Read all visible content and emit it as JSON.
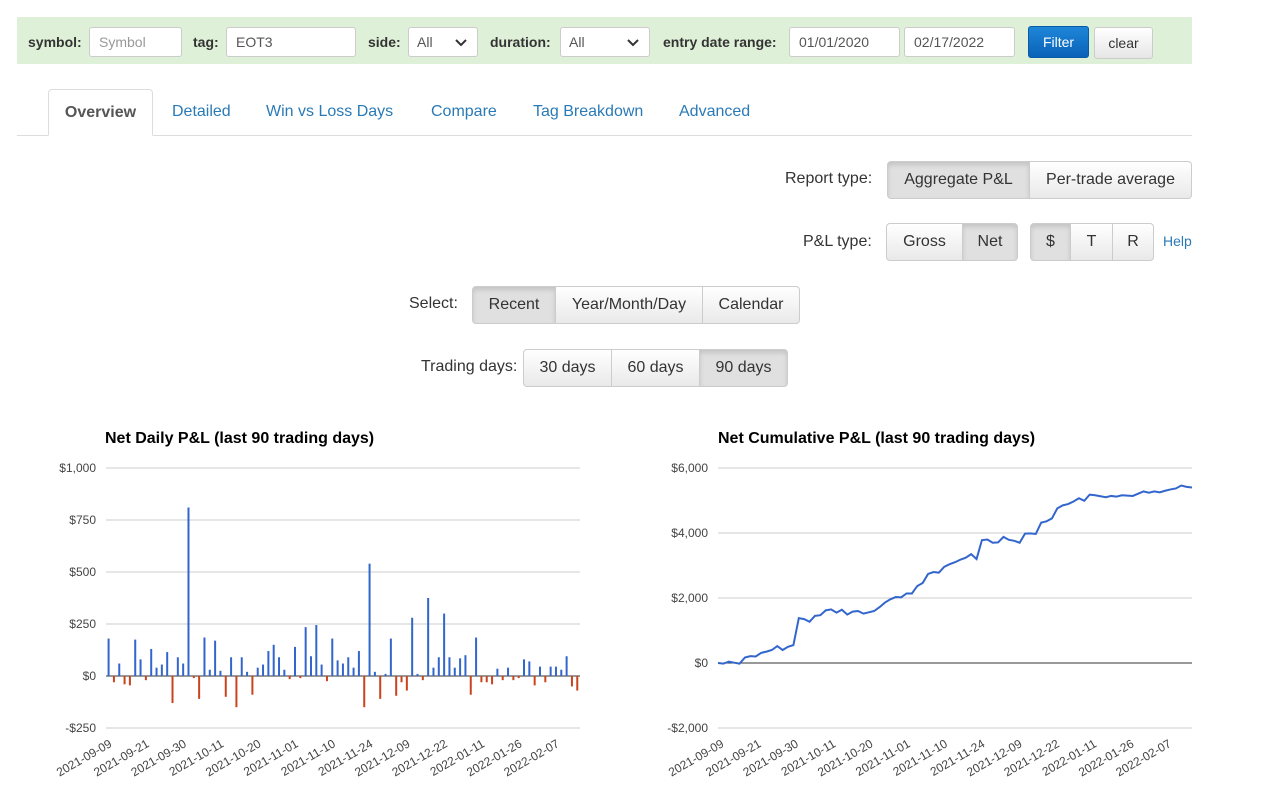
{
  "filter": {
    "symbol_label": "symbol:",
    "symbol_placeholder": "Symbol",
    "tag_label": "tag:",
    "tag_value": "EOT3",
    "side_label": "side:",
    "side_value": "All",
    "duration_label": "duration:",
    "duration_value": "All",
    "date_label": "entry date range:",
    "date_from": "01/01/2020",
    "date_to": "02/17/2022",
    "filter_button": "Filter",
    "clear_button": "clear"
  },
  "tabs": [
    {
      "label": "Overview",
      "active": true
    },
    {
      "label": "Detailed"
    },
    {
      "label": "Win vs Loss Days"
    },
    {
      "label": "Compare"
    },
    {
      "label": "Tag Breakdown"
    },
    {
      "label": "Advanced"
    }
  ],
  "controls": {
    "report_type_label": "Report type:",
    "report_type_options": [
      "Aggregate P&L",
      "Per-trade average"
    ],
    "report_type_selected": "Aggregate P&L",
    "pl_type_label": "P&L type:",
    "pl_type_options": [
      "Gross",
      "Net"
    ],
    "pl_type_selected": "Net",
    "unit_options": [
      "$",
      "T",
      "R"
    ],
    "unit_selected": "$",
    "help_link": "Help",
    "select_label": "Select:",
    "select_options": [
      "Recent",
      "Year/Month/Day",
      "Calendar"
    ],
    "select_selected": "Recent",
    "trading_days_label": "Trading days:",
    "trading_days_options": [
      "30 days",
      "60 days",
      "90 days"
    ],
    "trading_days_selected": "90 days"
  },
  "colors": {
    "positive_bar": "#3366cc",
    "negative_bar": "#c9441d",
    "line": "#3366cc",
    "filter_bg": "#dff0d8",
    "link": "#2a7ab6"
  },
  "chart_data": [
    {
      "type": "bar",
      "title": "Net Daily P&L (last 90 trading days)",
      "ylim": [
        -250,
        1000
      ],
      "y_ticks": [
        "$1,000",
        "$750",
        "$500",
        "$250",
        "$0",
        "-$250"
      ],
      "x_tick_labels": [
        "2021-09-09",
        "2021-09-21",
        "2021-09-30",
        "2021-10-11",
        "2021-10-20",
        "2021-11-01",
        "2021-11-10",
        "2021-11-24",
        "2021-12-09",
        "2021-12-22",
        "2022-01-11",
        "2022-01-26",
        "2022-02-07"
      ],
      "values": [
        180,
        -30,
        60,
        -40,
        -45,
        175,
        80,
        -20,
        130,
        40,
        55,
        115,
        -130,
        90,
        60,
        810,
        -10,
        -110,
        185,
        30,
        170,
        25,
        -100,
        90,
        -150,
        90,
        20,
        -90,
        40,
        55,
        120,
        150,
        90,
        30,
        -15,
        140,
        -10,
        235,
        95,
        245,
        55,
        -25,
        180,
        75,
        60,
        90,
        40,
        120,
        -150,
        540,
        20,
        -110,
        10,
        180,
        -95,
        -30,
        -70,
        280,
        10,
        -20,
        375,
        40,
        90,
        300,
        90,
        40,
        85,
        100,
        -90,
        185,
        -30,
        -30,
        -40,
        35,
        -20,
        40,
        -20,
        -10,
        80,
        70,
        -45,
        45,
        -30,
        45,
        45,
        30,
        95,
        -50,
        -70
      ]
    },
    {
      "type": "line",
      "title": "Net Cumulative P&L (last 90 trading days)",
      "ylim": [
        -2000,
        6000
      ],
      "y_ticks": [
        "$6,000",
        "$4,000",
        "$2,000",
        "$0",
        "-$2,000"
      ],
      "x_tick_labels": [
        "2021-09-09",
        "2021-09-21",
        "2021-09-30",
        "2021-10-11",
        "2021-10-20",
        "2021-11-01",
        "2021-11-10",
        "2021-11-24",
        "2021-12-09",
        "2021-12-22",
        "2022-01-11",
        "2022-01-26",
        "2022-02-07"
      ],
      "values": [
        0,
        -20,
        40,
        10,
        -20,
        170,
        210,
        200,
        310,
        350,
        400,
        520,
        400,
        500,
        550,
        1380,
        1350,
        1270,
        1450,
        1470,
        1620,
        1650,
        1550,
        1640,
        1490,
        1580,
        1600,
        1520,
        1560,
        1600,
        1720,
        1860,
        1960,
        2030,
        2020,
        2140,
        2140,
        2370,
        2460,
        2740,
        2800,
        2780,
        2960,
        3040,
        3100,
        3180,
        3240,
        3350,
        3200,
        3780,
        3800,
        3700,
        3710,
        3880,
        3790,
        3760,
        3700,
        3980,
        3990,
        3970,
        4320,
        4360,
        4450,
        4760,
        4850,
        4890,
        4970,
        5070,
        4990,
        5180,
        5160,
        5130,
        5100,
        5140,
        5120,
        5160,
        5150,
        5140,
        5210,
        5280,
        5240,
        5280,
        5250,
        5300,
        5340,
        5370,
        5460,
        5420,
        5400
      ]
    }
  ]
}
